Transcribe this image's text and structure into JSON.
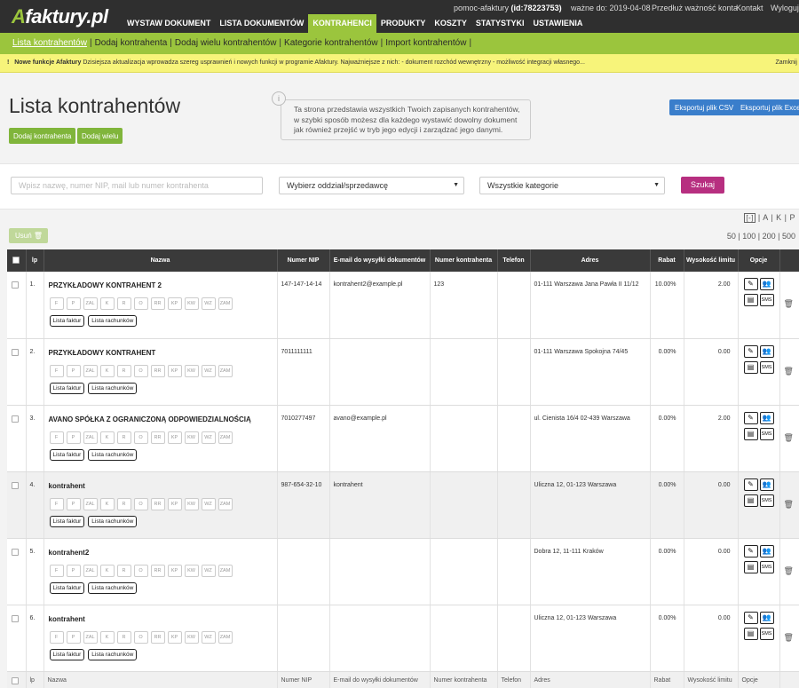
{
  "brand": {
    "logo_a": "A",
    "logo_rest": "faktury.pl",
    "accent": "#9bc53d"
  },
  "topbar": {
    "account": "pomoc-afaktury",
    "account_id": "(id:78223753)",
    "valid_label": "ważne do:",
    "valid_date": "2019-04-08",
    "extend": "Przedłuż ważność konta",
    "contact": "Kontakt",
    "logout": "Wyloguj"
  },
  "nav": [
    "WYSTAW DOKUMENT",
    "LISTA DOKUMENTÓW",
    "KONTRAHENCI",
    "PRODUKTY",
    "KOSZTY",
    "STATYSTYKI",
    "USTAWIENIA"
  ],
  "subnav": [
    "Lista kontrahentów",
    "Dodaj kontrahenta",
    "Dodaj wielu kontrahentów",
    "Kategorie kontrahentów",
    "Import kontrahentów"
  ],
  "notice": {
    "icon": "!",
    "bold": "Nowe funkcje Afaktury",
    "text": "Dzisiejsza aktualizacja wprowadza szereg usprawnień i nowych funkcji w programie Afaktury. Najważniejsze z nich: - dokument rozchód wewnętrzny - możliwość integracji własnego...",
    "close": "Zamknij"
  },
  "page": {
    "title": "Lista kontrahentów",
    "add_one": "Dodaj kontrahenta",
    "add_many": "Dodaj wielu",
    "info_icon": "i",
    "info": "Ta strona przedstawia wszystkich Twoich zapisanych kontrahentów, w szybki sposób możesz dla każdego wystawić dowolny dokument jak również przejść w tryb jego edycji i zarządzać jego danymi.",
    "export_csv": "Eksportuj plik CSV",
    "export_excel": "Eksportuj plik Excel"
  },
  "filter": {
    "search_placeholder": "Wpisz nazwę, numer NIP, mail lub numer kontrahenta",
    "branch": "Wybierz oddział/sprzedawcę",
    "category": "Wszystkie kategorie",
    "search_btn": "Szukaj"
  },
  "alpha": {
    "minus": "[-]",
    "letters": [
      "A",
      "K",
      "P"
    ]
  },
  "toolbar": {
    "delete": "Usuń",
    "page_sizes": [
      "50",
      "100",
      "200",
      "500"
    ]
  },
  "columns": [
    "lp",
    "Nazwa",
    "Numer NIP",
    "E-mail do wysyłki dokumentów",
    "Numer kontrahenta",
    "Telefon",
    "Adres",
    "Rabat",
    "Wysokość limitu",
    "Opcje"
  ],
  "footer_columns": [
    "lp",
    "Nazwa",
    "Numer NIP",
    "E-mail do wysyłki dokumentów",
    "Numer kontrahenta",
    "Telefon",
    "Adres",
    "Rabat",
    "Wysokość limitu",
    "Opcje"
  ],
  "doc_types": [
    "F",
    "P",
    "ZAL",
    "K",
    "R",
    "O",
    "RR",
    "KP",
    "KW",
    "WZ",
    "ZAM"
  ],
  "row_buttons": {
    "invoices": "Lista faktur",
    "bills": "Lista rachunków",
    "sms": "SMS"
  },
  "rows": [
    {
      "lp": "1.",
      "name": "PRZYKŁADOWY KONTRAHENT 2",
      "nip": "147-147-14-14",
      "email": "kontrahent2@example.pl",
      "number": "123",
      "phone": "",
      "address": "01-111 Warszawa Jana Pawła II 11/12",
      "discount": "10.00%",
      "limit": "2.00"
    },
    {
      "lp": "2.",
      "name": "PRZYKŁADOWY KONTRAHENT",
      "nip": "7011111111",
      "email": "",
      "number": "",
      "phone": "",
      "address": "01-111 Warszawa Spokojna 74/45",
      "discount": "0.00%",
      "limit": "0.00"
    },
    {
      "lp": "3.",
      "name": "AVANO SPÓŁKA Z OGRANICZONĄ ODPOWIEDZIALNOŚCIĄ",
      "nip": "7010277497",
      "email": "avano@example.pl",
      "number": "",
      "phone": "",
      "address": "ul. Cienista 16/4 02-439 Warszawa",
      "discount": "0.00%",
      "limit": "2.00"
    },
    {
      "lp": "4.",
      "name": "kontrahent",
      "nip": "987-654-32-10",
      "email": "kontrahent",
      "number": "",
      "phone": "",
      "address": "Uliczna 12, 01-123 Warszawa",
      "discount": "0.00%",
      "limit": "0.00"
    },
    {
      "lp": "5.",
      "name": "kontrahent2",
      "nip": "",
      "email": "",
      "number": "",
      "phone": "",
      "address": "Dobra 12, 11-111 Kraków",
      "discount": "0.00%",
      "limit": "0.00"
    },
    {
      "lp": "6.",
      "name": "kontrahent",
      "nip": "",
      "email": "",
      "number": "",
      "phone": "",
      "address": "Uliczna 12, 01-123 Warszawa",
      "discount": "0.00%",
      "limit": "0.00"
    }
  ]
}
